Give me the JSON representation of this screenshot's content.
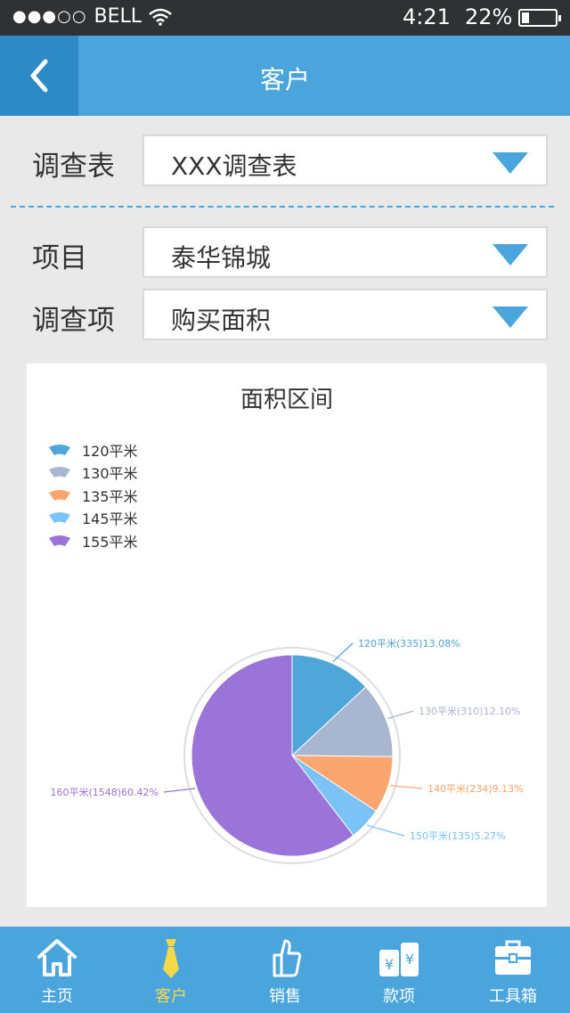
{
  "status_bar": {
    "carrier": "BELL",
    "signal_dots": "●●●○○",
    "time": "4:21",
    "battery": "22%"
  },
  "header": {
    "title": "客户"
  },
  "form": {
    "survey_label": "调查表",
    "survey_value": "XXX调查表",
    "project_label": "项目",
    "project_value": "泰华锦城",
    "item_label": "调查项",
    "item_value": "购买面积"
  },
  "chart_data": {
    "type": "pie",
    "title": "面积区间",
    "legend": [
      {
        "label": "120平米",
        "color": "#4fa6d8"
      },
      {
        "label": "130平米",
        "color": "#a9b6cf"
      },
      {
        "label": "135平米",
        "color": "#fba66e"
      },
      {
        "label": "145平米",
        "color": "#7bc2f6"
      },
      {
        "label": "155平米",
        "color": "#9b74d9"
      }
    ],
    "slices": [
      {
        "label": "120平米(335)13.08%",
        "value": 335,
        "percent": 13.08,
        "color": "#4fa6d8"
      },
      {
        "label": "130平米(310)12.10%",
        "value": 310,
        "percent": 12.1,
        "color": "#a9b6cf"
      },
      {
        "label": "140平米(234)9.13%",
        "value": 234,
        "percent": 9.13,
        "color": "#fba66e"
      },
      {
        "label": "150平米(135)5.27%",
        "value": 135,
        "percent": 5.27,
        "color": "#7bc2f6"
      },
      {
        "label": "160平米(1548)60.42%",
        "value": 1548,
        "percent": 60.42,
        "color": "#9b74d9"
      }
    ]
  },
  "tabs": [
    {
      "label": "主页",
      "icon": "home-icon",
      "active": false
    },
    {
      "label": "客户",
      "icon": "tie-icon",
      "active": true
    },
    {
      "label": "销售",
      "icon": "thumbs-up-icon",
      "active": false
    },
    {
      "label": "款项",
      "icon": "coins-icon",
      "active": false
    },
    {
      "label": "工具箱",
      "icon": "toolbox-icon",
      "active": false
    }
  ],
  "colors": {
    "accent": "#4aa5dc",
    "active_tab": "#f5d84a",
    "status_bar": "#303132"
  }
}
